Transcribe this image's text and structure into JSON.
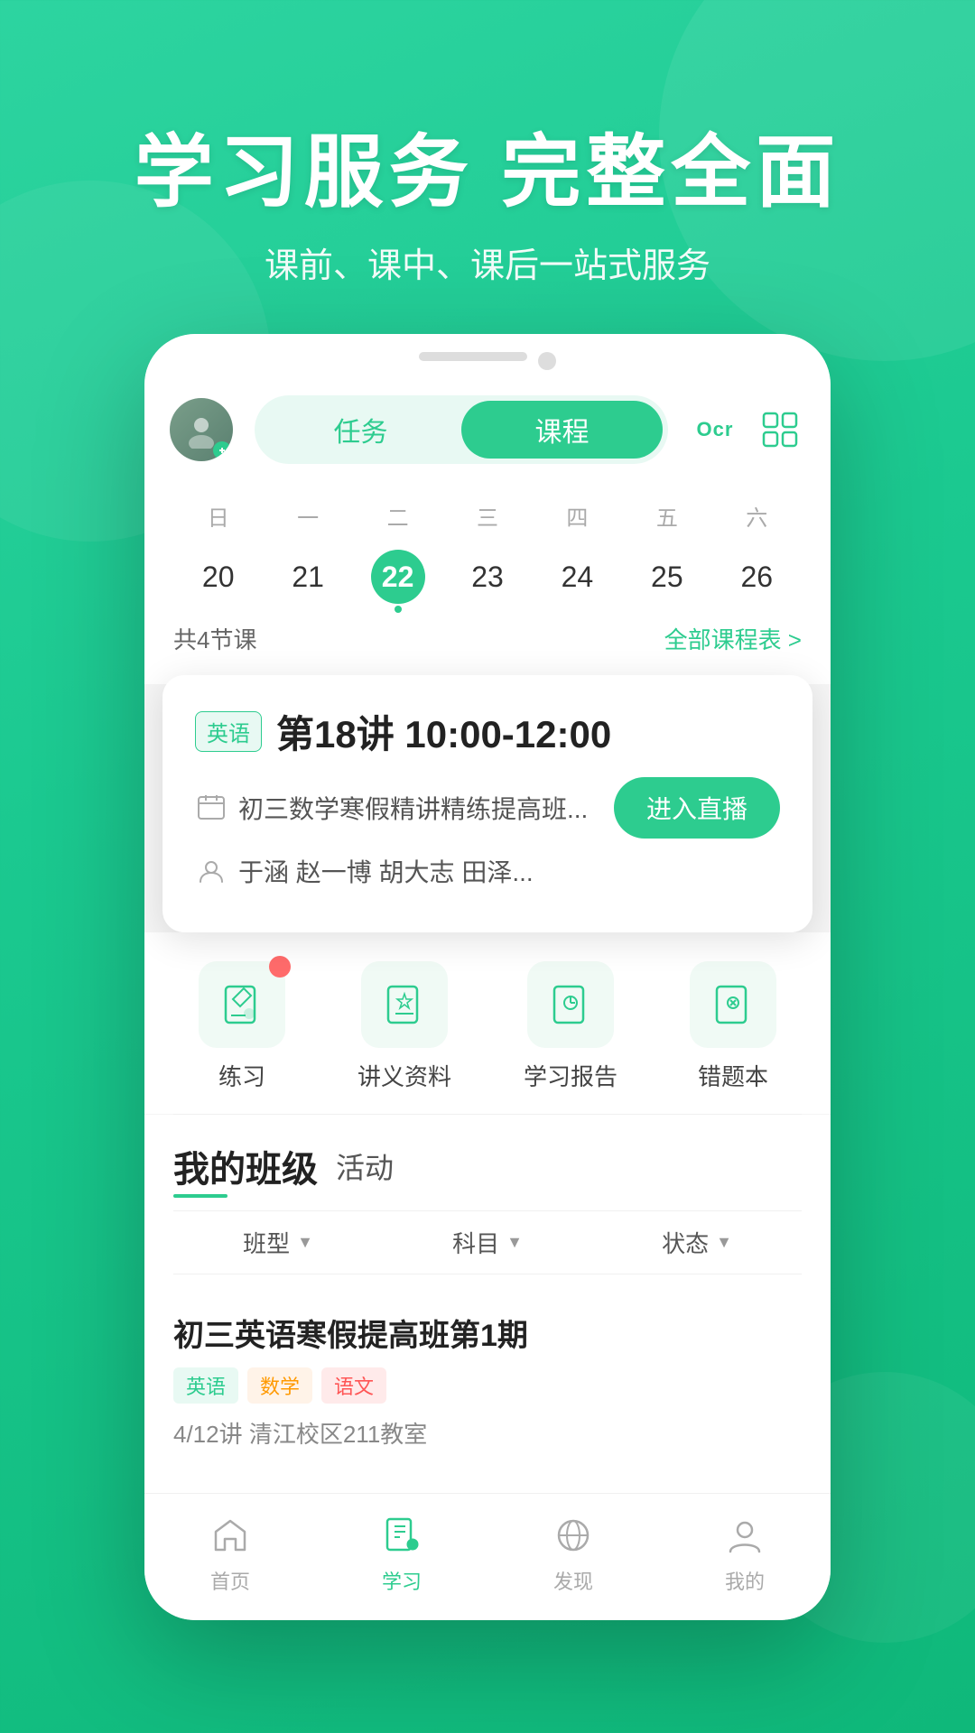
{
  "hero": {
    "title": "学习服务  完整全面",
    "subtitle": "课前、课中、课后一站式服务"
  },
  "nav": {
    "tab_task": "任务",
    "tab_course": "课程",
    "ocr_label": "Ocr",
    "active_tab": "course"
  },
  "calendar": {
    "weekdays": [
      "日",
      "一",
      "二",
      "三",
      "四",
      "五",
      "六"
    ],
    "dates": [
      {
        "date": "20",
        "today": false
      },
      {
        "date": "21",
        "today": false
      },
      {
        "date": "22",
        "today": true
      },
      {
        "date": "23",
        "today": false
      },
      {
        "date": "24",
        "today": false
      },
      {
        "date": "25",
        "today": false
      },
      {
        "date": "26",
        "today": false
      }
    ],
    "class_count": "共4节课",
    "view_all": "全部课程表 >"
  },
  "course_card": {
    "subject_tag": "英语",
    "title": "第18讲 10:00-12:00",
    "class_name": "初三数学寒假精讲精练提高班...",
    "teachers": "于涵  赵一博  胡大志  田泽...",
    "live_btn": "进入直播"
  },
  "tools": [
    {
      "label": "练习",
      "badge": true,
      "icon": "pencil"
    },
    {
      "label": "讲义资料",
      "badge": false,
      "icon": "star"
    },
    {
      "label": "学习报告",
      "badge": false,
      "icon": "lightbulb"
    },
    {
      "label": "错题本",
      "badge": false,
      "icon": "book"
    }
  ],
  "my_class": {
    "title": "我的班级",
    "tab_active": "活动",
    "filters": [
      "班型",
      "科目",
      "状态"
    ],
    "class_item": {
      "name": "初三英语寒假提高班第1期",
      "tags": [
        {
          "label": "英语",
          "type": "english"
        },
        {
          "label": "数学",
          "type": "math"
        },
        {
          "label": "语文",
          "type": "chinese"
        }
      ],
      "detail": "4/12讲  清江校区211教室"
    }
  },
  "bottom_nav": [
    {
      "label": "首页",
      "active": false,
      "icon": "home"
    },
    {
      "label": "学习",
      "active": true,
      "icon": "book-open"
    },
    {
      "label": "发现",
      "active": false,
      "icon": "compass"
    },
    {
      "label": "我的",
      "active": false,
      "icon": "user"
    }
  ]
}
